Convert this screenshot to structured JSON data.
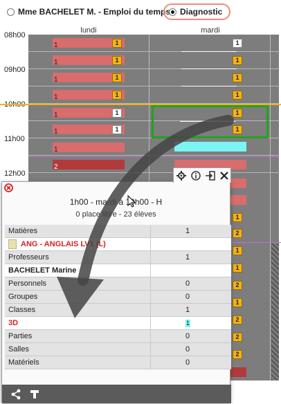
{
  "tabs": {
    "schedule": "Mme BACHELET M. - Emploi du temps",
    "diagnostic": "Diagnostic"
  },
  "hours": [
    "08h00",
    "09h00",
    "10h00",
    "11h00",
    "12h00"
  ],
  "days": [
    "lundi",
    "mardi"
  ],
  "grid": {
    "lundi_numbers": [
      "1",
      "1",
      "1",
      "1",
      "1",
      "1",
      "1",
      "2"
    ],
    "badge_one": "1",
    "badge_two": "2"
  },
  "popup": {
    "header": "1h00 - mardi à 10h00 - H",
    "subheader": "0 place libre - 23 élèves",
    "rows": [
      {
        "label": "Matières",
        "value": "1"
      },
      {
        "label": "ANG - ANGLAIS LV1 (L)",
        "value": ""
      },
      {
        "label": "Professeurs",
        "value": "1"
      },
      {
        "label": "BACHELET Marine",
        "value": ""
      },
      {
        "label": "Personnels",
        "value": "0"
      },
      {
        "label": "Groupes",
        "value": "0"
      },
      {
        "label": "Classes",
        "value": "1"
      },
      {
        "label": "3D",
        "value": "1"
      },
      {
        "label": "Parties",
        "value": "0"
      },
      {
        "label": "Salles",
        "value": "0"
      },
      {
        "label": "Matériels",
        "value": "0"
      }
    ]
  },
  "colors": {
    "grid": "#7d7d7d",
    "course": "#d96c6c",
    "badge": "#f2b21b",
    "selection": "#1fa51f",
    "accent_red": "#d62020"
  }
}
